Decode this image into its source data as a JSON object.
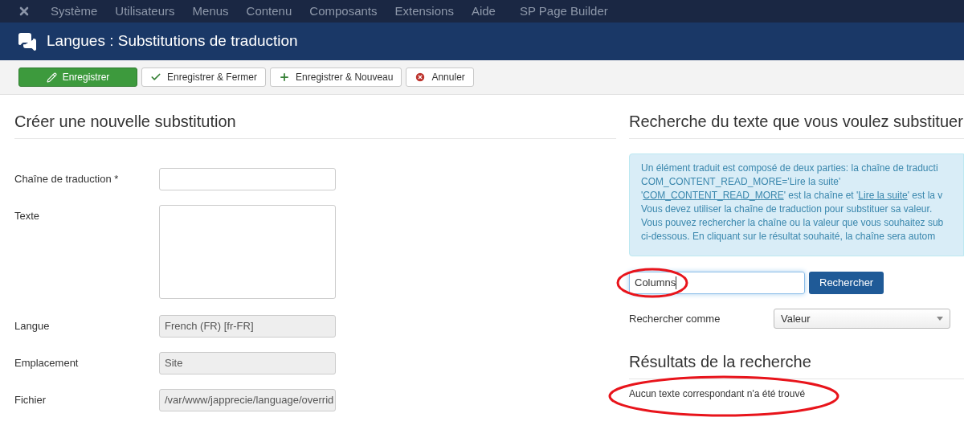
{
  "menu": [
    "Système",
    "Utilisateurs",
    "Menus",
    "Contenu",
    "Composants",
    "Extensions",
    "Aide",
    "SP Page Builder"
  ],
  "title": "Langues : Substitutions de traduction",
  "toolbar": [
    {
      "kind": "save",
      "label": "Enregistrer"
    },
    {
      "kind": "check",
      "label": "Enregistrer & Fermer"
    },
    {
      "kind": "plus",
      "label": "Enregistrer & Nouveau"
    },
    {
      "kind": "cancel",
      "label": "Annuler"
    }
  ],
  "form": {
    "heading": "Créer une nouvelle substitution",
    "fields": [
      {
        "kind": "input",
        "label": "Chaîne de traduction *",
        "disabled": false
      },
      {
        "kind": "textarea",
        "label": "Texte",
        "disabled": false
      },
      {
        "kind": "input",
        "label": "Langue",
        "value": "French (FR) [fr-FR]",
        "disabled": true
      },
      {
        "kind": "input",
        "label": "Emplacement",
        "value": "Site",
        "disabled": true
      },
      {
        "kind": "input",
        "label": "Fichier",
        "value": "/var/www/japprecie/language/overrid",
        "disabled": true
      }
    ]
  },
  "search": {
    "heading": "Recherche du texte que vous voulez substituer",
    "info_lines": [
      [
        {
          "kind": "text",
          "text": "Un élément traduit est composé de deux parties: la chaîne de traducti"
        }
      ],
      [
        {
          "kind": "text",
          "text": "COM_CONTENT_READ_MORE='Lire la suite'"
        }
      ],
      [
        {
          "kind": "text",
          "text": "'"
        },
        {
          "kind": "link",
          "text": "COM_CONTENT_READ_MORE"
        },
        {
          "kind": "text",
          "text": "' est la chaîne et '"
        },
        {
          "kind": "link",
          "text": "Lire la suite"
        },
        {
          "kind": "text",
          "text": "' est la v"
        }
      ],
      [
        {
          "kind": "text",
          "text": "Vous devez utiliser la chaîne de traduction pour substituer sa valeur."
        }
      ],
      [
        {
          "kind": "text",
          "text": "Vous pouvez rechercher la chaîne ou la valeur que vous souhaitez sub"
        }
      ],
      [
        {
          "kind": "text",
          "text": "ci-dessous. En cliquant sur le résultat souhaité, la chaîne sera autom"
        }
      ]
    ],
    "query": "Columns",
    "button": "Rechercher",
    "search_as_label": "Rechercher comme",
    "search_as_value": "Valeur",
    "results_heading": "Résultats de la recherche",
    "no_results": "Aucun texte correspondant n'a été trouvé"
  }
}
